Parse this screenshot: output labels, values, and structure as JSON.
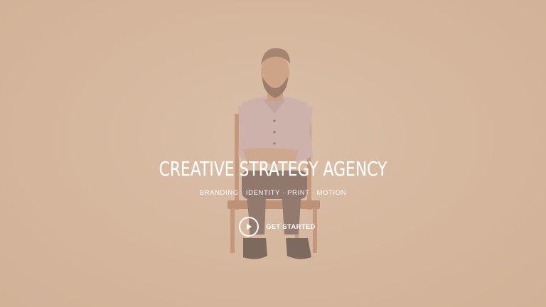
{
  "hero": {
    "headline": "CREATIVE STRATEGY AGENCY",
    "tagline": "BRANDING · IDENTITY · PRINT · MOTION",
    "cta_label": "GET STARTED",
    "cta_icon": "play-icon"
  },
  "colors": {
    "background": "#d6b9a0",
    "text": "#ffffff"
  }
}
